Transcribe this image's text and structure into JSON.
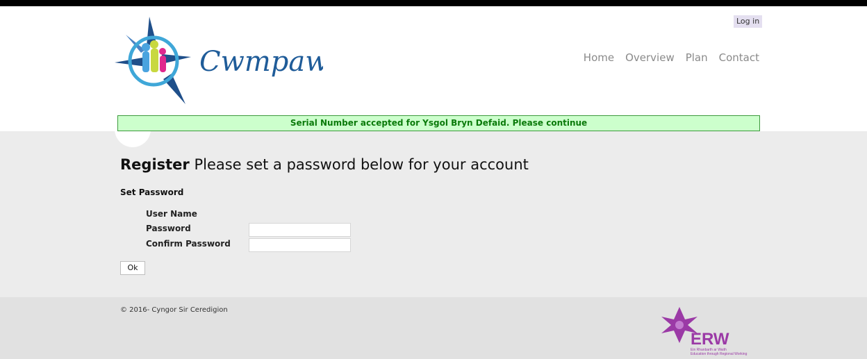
{
  "header": {
    "brand": "Cwmpawd",
    "login_label": "Log in",
    "nav": [
      "Home",
      "Overview",
      "Plan",
      "Contact"
    ]
  },
  "notice": "Serial Number accepted for Ysgol Bryn Defaid. Please continue",
  "page": {
    "title_bold": "Register",
    "title_rest": " Please set a password below for your account",
    "section": "Set Password",
    "labels": {
      "username": "User Name",
      "password": "Password",
      "confirm": "Confirm Password"
    },
    "username_value": "",
    "ok_label": "Ok"
  },
  "footer": {
    "copyright": "© 2016- Cyngor Sir Ceredigion",
    "erw_logo_text": "ERW",
    "erw_tagline_1": "Ein Rhanbarth ar Waith",
    "erw_tagline_2": "Education through Regional Working"
  },
  "colors": {
    "notice_bg": "#ccffcc",
    "notice_text": "#0a7a0a",
    "brand_blue": "#1f5c99",
    "erw_purple": "#9b3aa6"
  },
  "icons": {
    "logo": "compass-people-logo",
    "erw": "erw-star-logo"
  }
}
